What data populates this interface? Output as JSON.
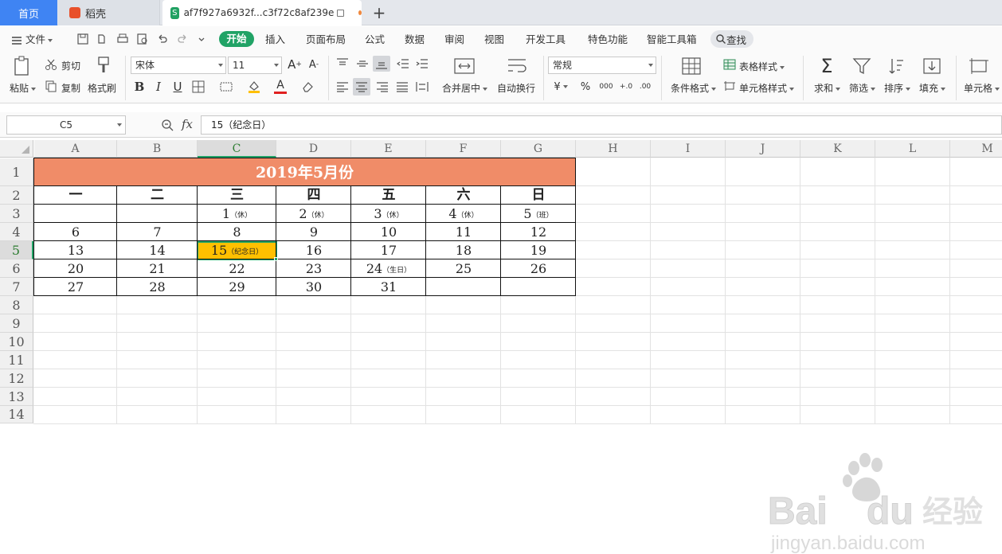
{
  "tabs": {
    "home": "首页",
    "daoke": "稻壳",
    "file": "af7f927a6932f...c3f72c8af239e",
    "file_icon": "S",
    "add": "+"
  },
  "menu": {
    "file": "文件",
    "items": [
      "开始",
      "插入",
      "页面布局",
      "公式",
      "数据",
      "审阅",
      "视图",
      "开发工具",
      "特色功能",
      "智能工具箱"
    ],
    "search": "查找"
  },
  "ribbon": {
    "paste": "粘贴",
    "cut": "剪切",
    "copy": "复制",
    "format_painter": "格式刷",
    "font_name": "宋体",
    "font_size": "11",
    "bold": "B",
    "italic": "I",
    "underline": "U",
    "merge_center": "合并居中",
    "wrap_text": "自动换行",
    "number_format": "常规",
    "currency": "¥",
    "percent": "%",
    "thousands": "000",
    "dec_inc": "+.0",
    "dec_dec": ".00",
    "conditional_format": "条件格式",
    "table_style": "表格样式",
    "cell_style": "单元格样式",
    "sum": "求和",
    "filter": "筛选",
    "sort": "排序",
    "fill": "填充",
    "cells": "单元格"
  },
  "formula_bar": {
    "name_box": "C5",
    "fx": "fx",
    "content": "15（纪念日）"
  },
  "grid": {
    "columns": [
      "A",
      "B",
      "C",
      "D",
      "E",
      "F",
      "G",
      "H",
      "I",
      "J",
      "K",
      "L",
      "M"
    ],
    "rows": [
      "1",
      "2",
      "3",
      "4",
      "5",
      "6",
      "7",
      "8",
      "9",
      "10",
      "11",
      "12",
      "13",
      "14"
    ],
    "selected_col": "C",
    "selected_row": "5",
    "active_fill": "#ffc000",
    "title_fill": "#f08c68"
  },
  "calendar": {
    "title": "2019年5月份",
    "weekdays": [
      "一",
      "二",
      "三",
      "四",
      "五",
      "六",
      "日"
    ],
    "weeks": [
      [
        {
          "d": ""
        },
        {
          "d": ""
        },
        {
          "d": "1",
          "n": "（休）"
        },
        {
          "d": "2",
          "n": "（休）"
        },
        {
          "d": "3",
          "n": "（休）"
        },
        {
          "d": "4",
          "n": "（休）"
        },
        {
          "d": "5",
          "n": "（班）"
        }
      ],
      [
        {
          "d": "6"
        },
        {
          "d": "7"
        },
        {
          "d": "8"
        },
        {
          "d": "9"
        },
        {
          "d": "10"
        },
        {
          "d": "11"
        },
        {
          "d": "12"
        }
      ],
      [
        {
          "d": "13"
        },
        {
          "d": "14"
        },
        {
          "d": "15",
          "n": "（纪念日）"
        },
        {
          "d": "16"
        },
        {
          "d": "17"
        },
        {
          "d": "18"
        },
        {
          "d": "19"
        }
      ],
      [
        {
          "d": "20"
        },
        {
          "d": "21"
        },
        {
          "d": "22"
        },
        {
          "d": "23"
        },
        {
          "d": "24",
          "n": "（生日）"
        },
        {
          "d": "25"
        },
        {
          "d": "26"
        }
      ],
      [
        {
          "d": "27"
        },
        {
          "d": "28"
        },
        {
          "d": "29"
        },
        {
          "d": "30"
        },
        {
          "d": "31"
        },
        {
          "d": ""
        },
        {
          "d": ""
        }
      ]
    ]
  },
  "watermark": {
    "brand": "Bai",
    "brand2": "du",
    "cn": "经验",
    "url": "jingyan.baidu.com"
  }
}
